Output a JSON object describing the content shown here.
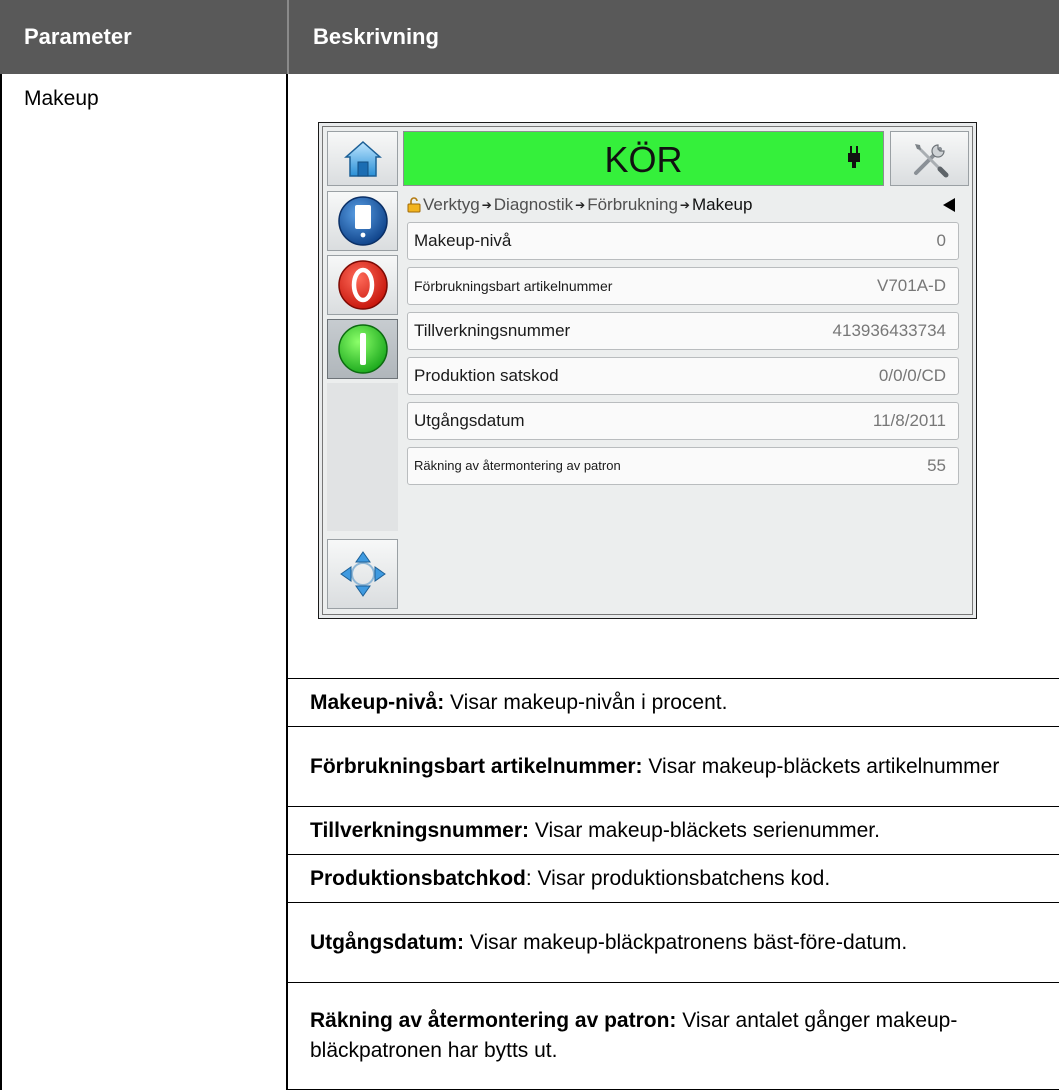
{
  "table": {
    "header_param": "Parameter",
    "header_desc": "Beskrivning",
    "param_name": "Makeup"
  },
  "device": {
    "status_text": "KÖR",
    "breadcrumb": {
      "items": [
        "Verktyg",
        "Diagnostik",
        "Förbrukning"
      ],
      "current": "Makeup"
    },
    "rows": [
      {
        "label": "Makeup-nivå",
        "value": "0"
      },
      {
        "label": "Förbrukningsbart artikelnummer",
        "value": "V701A-D"
      },
      {
        "label": "Tillverkningsnummer",
        "value": "413936433734"
      },
      {
        "label": "Produktion satskod",
        "value": "0/0/0/CD"
      },
      {
        "label": "Utgångsdatum",
        "value": "11/8/2011"
      },
      {
        "label": "Räkning av återmontering av patron",
        "value": "55"
      }
    ],
    "status_color": "#35f03b"
  },
  "descriptions": [
    {
      "term": "Makeup-nivå:",
      "text": " Visar makeup-nivån i procent."
    },
    {
      "term": "Förbrukningsbart artikelnummer:",
      "text": " Visar makeup-bläckets artikelnummer"
    },
    {
      "term": "Tillverkningsnummer:",
      "text": " Visar makeup-bläckets serienummer."
    },
    {
      "term": "Produktionsbatchkod",
      "text": ": Visar produktionsbatchens kod."
    },
    {
      "term": "Utgångsdatum:",
      "text": " Visar makeup-bläckpatronens bäst-före-datum."
    },
    {
      "term": "Räkning av återmontering av patron:",
      "text": " Visar antalet gånger makeup-bläckpatronen har bytts ut."
    }
  ]
}
